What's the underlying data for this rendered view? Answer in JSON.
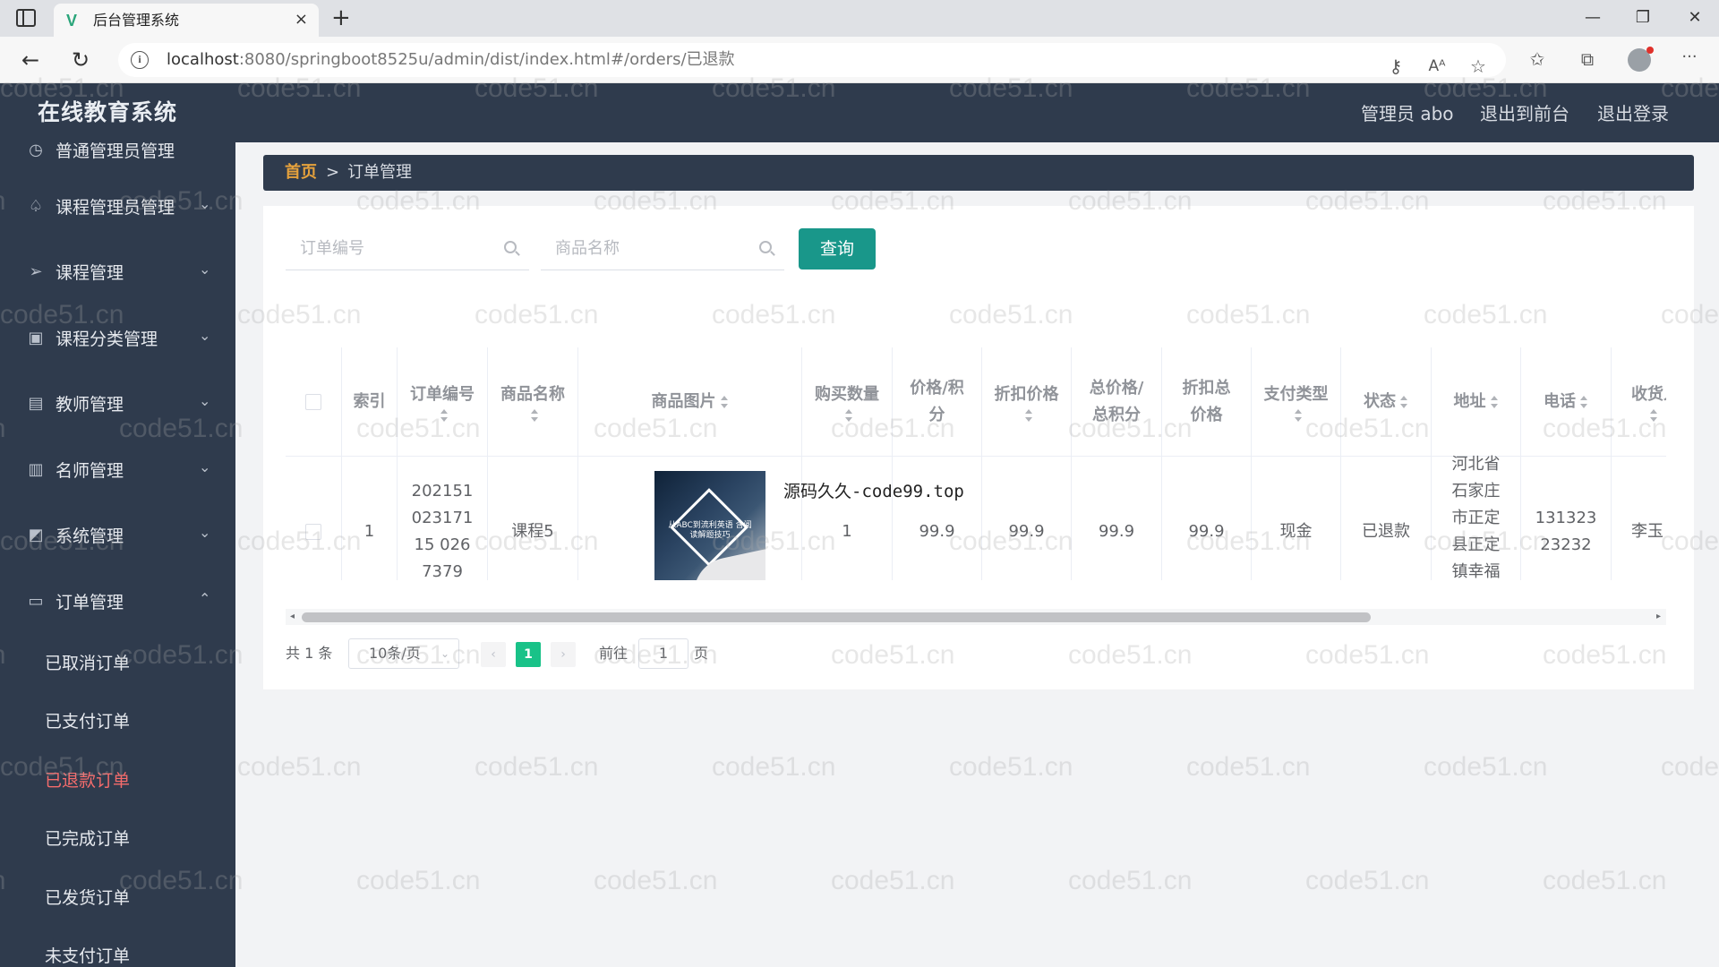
{
  "browser": {
    "tab_title": "后台管理系统",
    "tab_close": "×",
    "new_tab": "+",
    "url_host": "localhost",
    "url_rest": ":8080/springboot8525u/admin/dist/index.html#/orders/已退款",
    "win_minimize": "—",
    "win_restore": "❐",
    "win_close": "✕",
    "back": "←",
    "reload": "↻",
    "more": "···"
  },
  "header": {
    "logo": "在线教育系统",
    "admin": "管理员 abo",
    "exit_front": "退出到前台",
    "logout": "退出登录"
  },
  "sidebar": {
    "top_partial": "普通管理员管理",
    "items": [
      {
        "label": "课程管理员管理",
        "icon": "bell-icon",
        "arrow": "⌄"
      },
      {
        "label": "课程管理",
        "icon": "send-icon",
        "arrow": "⌄"
      },
      {
        "label": "课程分类管理",
        "icon": "clipboard-icon",
        "arrow": "⌄"
      },
      {
        "label": "教师管理",
        "icon": "chat-icon",
        "arrow": "⌄"
      },
      {
        "label": "名师管理",
        "icon": "bar-chart-icon",
        "arrow": "⌄"
      },
      {
        "label": "系统管理",
        "icon": "trend-icon",
        "arrow": "⌄"
      },
      {
        "label": "订单管理",
        "icon": "list-icon",
        "arrow": "⌃"
      }
    ],
    "sub_items": [
      "已取消订单",
      "已支付订单",
      "已退款订单",
      "已完成订单",
      "已发货订单",
      "未支付订单"
    ],
    "active_sub": "已退款订单"
  },
  "breadcrumb": {
    "home": "首页",
    "sep": ">",
    "current": "订单管理"
  },
  "search": {
    "order_placeholder": "订单编号",
    "product_placeholder": "商品名称",
    "query_label": "查询"
  },
  "table": {
    "headers": {
      "index": "索引",
      "order_no": "订单编号",
      "product_name": "商品名称",
      "product_img": "商品图片",
      "qty": "购买数量",
      "price": "价格/积分",
      "discount_price": "折扣价格",
      "total": "总价格/总积分",
      "discount_total": "折扣总价格",
      "pay_type": "支付类型",
      "status": "状态",
      "address": "地址",
      "phone": "电话",
      "receiver": "收货人"
    },
    "row": {
      "index": "1",
      "order_no": "20215102317115 0267379",
      "product_name": "课程5",
      "qty": "1",
      "price": "99.9",
      "discount_price": "99.9",
      "total": "99.9",
      "discount_total": "99.9",
      "pay_type": "现金",
      "status": "已退款",
      "address": "河北省石家庄市正定县正定镇幸福小郡",
      "phone": "13132323232",
      "receiver": "李玉"
    },
    "image_caption": "从ABC到流利英语 含阅读解题技巧"
  },
  "pagination": {
    "total": "共 1 条",
    "page_size": "10条/页",
    "current": "1",
    "goto": "前往",
    "goto_value": "1",
    "unit": "页",
    "prev": "‹",
    "next": "›"
  },
  "overlay": "源码久久-code99.top",
  "watermark": "code51.cn",
  "colors": {
    "sidebar_bg": "#2f3b4d",
    "accent": "#19978a",
    "active_menu": "#f56c6c",
    "page_active": "#19c288"
  }
}
